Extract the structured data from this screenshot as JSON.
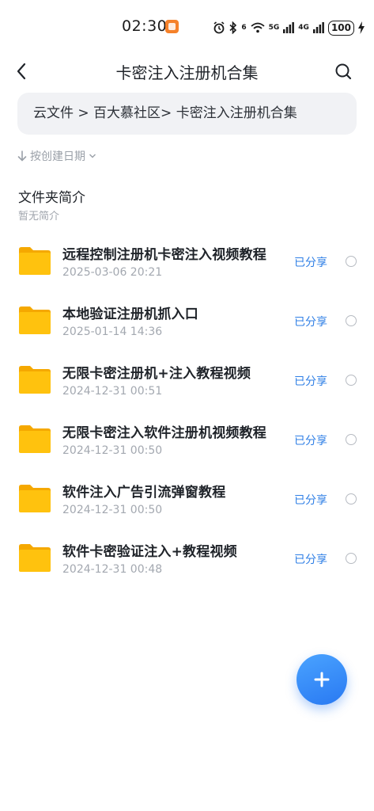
{
  "status_bar": {
    "time": "02:30",
    "network_5g": "5G",
    "network_4g": "4G",
    "wifi_label": "6",
    "battery": "100"
  },
  "header": {
    "title": "卡密注入注册机合集"
  },
  "breadcrumb": {
    "text": "云文件 > 百大慕社区> 卡密注入注册机合集"
  },
  "sort": {
    "label": "按创建日期"
  },
  "folder_intro": {
    "title": "文件夹简介",
    "description": "暂无简介"
  },
  "files": [
    {
      "name": "远程控制注册机卡密注入视频教程",
      "date": "2025-03-06 20:21",
      "status": "已分享"
    },
    {
      "name": "本地验证注册机抓入口",
      "date": "2025-01-14 14:36",
      "status": "已分享"
    },
    {
      "name": "无限卡密注册机+注入教程视频",
      "date": "2024-12-31 00:51",
      "status": "已分享"
    },
    {
      "name": "无限卡密注入软件注册机视频教程",
      "date": "2024-12-31 00:50",
      "status": "已分享"
    },
    {
      "name": "软件注入广告引流弹窗教程",
      "date": "2024-12-31 00:50",
      "status": "已分享"
    },
    {
      "name": "软件卡密验证注入+教程视频",
      "date": "2024-12-31 00:48",
      "status": "已分享"
    }
  ],
  "colors": {
    "accent": "#2f7fe6",
    "folder": "#ffc20e",
    "breadcrumb_bg": "#f1f2f5"
  },
  "icons": {
    "back": "chevron-left-icon",
    "search": "search-icon",
    "folder": "folder-icon",
    "add": "plus-icon",
    "sort": "arrow-down-icon"
  }
}
